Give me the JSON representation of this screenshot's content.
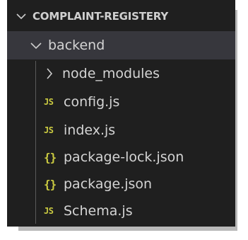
{
  "explorer": {
    "root_folder": {
      "label": "COMPLAINT-REGISTERY",
      "expanded": true,
      "icon": "chevron-down-icon"
    },
    "backend_folder": {
      "label": "backend",
      "expanded": true,
      "icon": "chevron-down-icon"
    },
    "items": [
      {
        "label": "node_modules",
        "kind": "folder",
        "expanded": false,
        "icon": "chevron-right-icon"
      },
      {
        "label": "config.js",
        "kind": "file",
        "icon_text": "JS",
        "icon": "javascript-file-icon"
      },
      {
        "label": "index.js",
        "kind": "file",
        "icon_text": "JS",
        "icon": "javascript-file-icon"
      },
      {
        "label": "package-lock.json",
        "kind": "file",
        "icon_text": "{}",
        "icon": "json-file-icon"
      },
      {
        "label": "package.json",
        "kind": "file",
        "icon_text": "{}",
        "icon": "json-file-icon"
      },
      {
        "label": "Schema.js",
        "kind": "file",
        "icon_text": "JS",
        "icon": "javascript-file-icon"
      }
    ]
  },
  "colors": {
    "panel_background": "#1f1f1f",
    "selected_row": "#37373d",
    "text": "#d4d4d4",
    "js_icon": "#cbcb41",
    "json_icon": "#cbcb41"
  }
}
